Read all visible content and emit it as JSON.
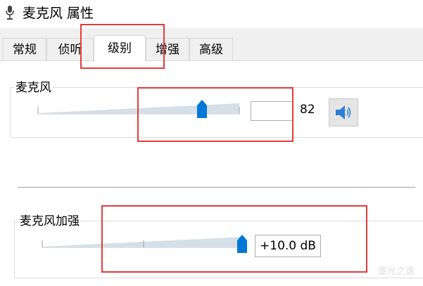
{
  "window": {
    "title": "麦克风 属性"
  },
  "tabs": [
    {
      "label": "常规"
    },
    {
      "label": "侦听"
    },
    {
      "label": "级别",
      "active": true
    },
    {
      "label": "增强"
    },
    {
      "label": "高级"
    }
  ],
  "microphone": {
    "group_label": "麦克风",
    "level_value": "82",
    "level_fraction": 0.82,
    "mute_button_icon": "speaker-icon"
  },
  "boost": {
    "group_label": "麦克风加强",
    "value": "+10.0 dB",
    "level_fraction": 1.0
  },
  "watermark": {
    "text": "逐光之速"
  },
  "colors": {
    "thumb": "#0078d7",
    "highlight": "#e23b3b",
    "track": "#d5dfe8"
  }
}
